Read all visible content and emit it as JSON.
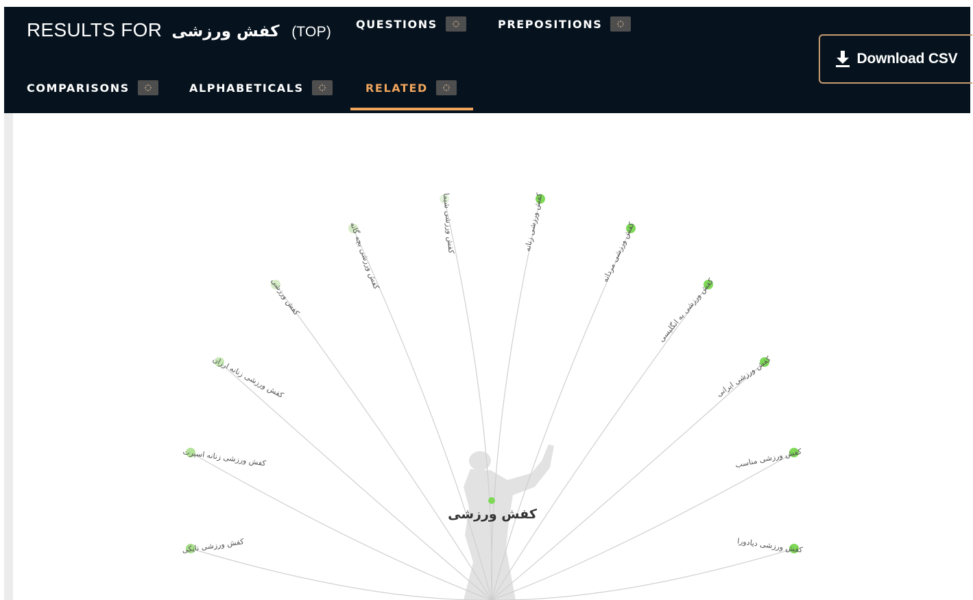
{
  "header": {
    "title_prefix": "RESULTS FOR",
    "query": "کفش ورزشی",
    "title_suffix": "(TOP)"
  },
  "tabs": [
    {
      "label": "QUESTIONS",
      "active": false
    },
    {
      "label": "PREPOSITIONS",
      "active": false
    },
    {
      "label": "COMPARISONS",
      "active": false
    },
    {
      "label": "ALPHABETICALS",
      "active": false
    },
    {
      "label": "RELATED",
      "active": true
    }
  ],
  "download_button": {
    "label": "Download CSV",
    "icon": "download-icon"
  },
  "graph": {
    "center": "کفش ورزشی",
    "nodes": [
      {
        "label": "کفش ورزشی دیادورا",
        "color": "#7ed957"
      },
      {
        "label": "کفش ورزشی مناسب",
        "color": "#7ed957"
      },
      {
        "label": "کفش ورزشی ایرانی",
        "color": "#7ed957"
      },
      {
        "label": "کفش ورزشی به انگلیسی",
        "color": "#7ed957"
      },
      {
        "label": "کفش ورزشی مردانه",
        "color": "#7ed957"
      },
      {
        "label": "کفش ورزشی زنانه",
        "color": "#7ed957"
      },
      {
        "label": "کفش ورزشی شیما",
        "color": "#e4f3dc"
      },
      {
        "label": "کفش ورزشی بچه گانه",
        "color": "#d6ecc7"
      },
      {
        "label": "کفش ورزشی",
        "color": "#d6ecc7"
      },
      {
        "label": "کفش ورزشی زنانه ارزان",
        "color": "#c6e8b4"
      },
      {
        "label": "کفش ورزشی زنانه اسپرت",
        "color": "#b4e39b"
      },
      {
        "label": "کفش ورزشی نایکی",
        "color": "#a9df8c"
      }
    ],
    "colors": {
      "center_node": "#7ed957",
      "edge": "#cfcfcf",
      "silhouette": "#e2e2e2"
    }
  }
}
